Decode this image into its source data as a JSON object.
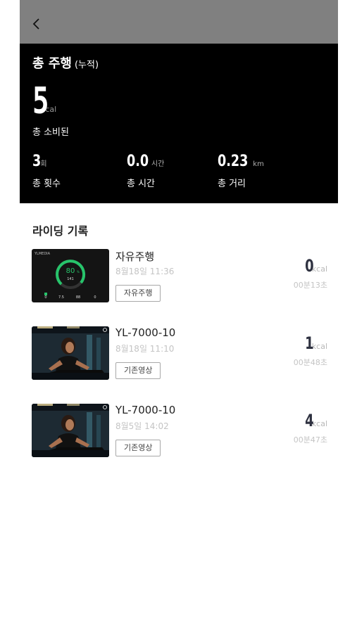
{
  "summary": {
    "title": "총 주행",
    "title_sub": "(누적)",
    "calories": {
      "value": "5",
      "unit": "cal",
      "label": "총 소비된"
    },
    "count": {
      "value": "3",
      "unit": "회",
      "label": "총 횟수"
    },
    "time": {
      "value": "0.0",
      "unit": "시간",
      "label": "총 시간"
    },
    "distance": {
      "value": "0.23",
      "unit": "km",
      "label": "총 거리"
    }
  },
  "records": {
    "title": "라이딩 기록",
    "items": [
      {
        "name": "자유주행",
        "date": "8월18일  11:36",
        "tag": "자유주행",
        "kcal": "0",
        "kcal_unit": "kcal",
        "duration": "00분13초",
        "thumb": "dashboard"
      },
      {
        "name": "YL-7000-10",
        "date": "8월18일  11:10",
        "tag": "기존영상",
        "kcal": "1",
        "kcal_unit": "kcal",
        "duration": "00분48초",
        "thumb": "photo"
      },
      {
        "name": "YL-7000-10",
        "date": "8월5일  14:02",
        "tag": "기존영상",
        "kcal": "4",
        "kcal_unit": "kcal",
        "duration": "00분47초",
        "thumb": "photo"
      }
    ]
  },
  "thumb_dashboard": {
    "brand": "YLMEDIA",
    "gauge_value": "80",
    "gauge_unit": "%",
    "gauge_sub": "141",
    "stats": [
      "0",
      "7.5",
      "88",
      "0"
    ]
  },
  "colors": {
    "header": "#808080",
    "summary_bg": "#000000",
    "gauge": "#27c46b"
  }
}
